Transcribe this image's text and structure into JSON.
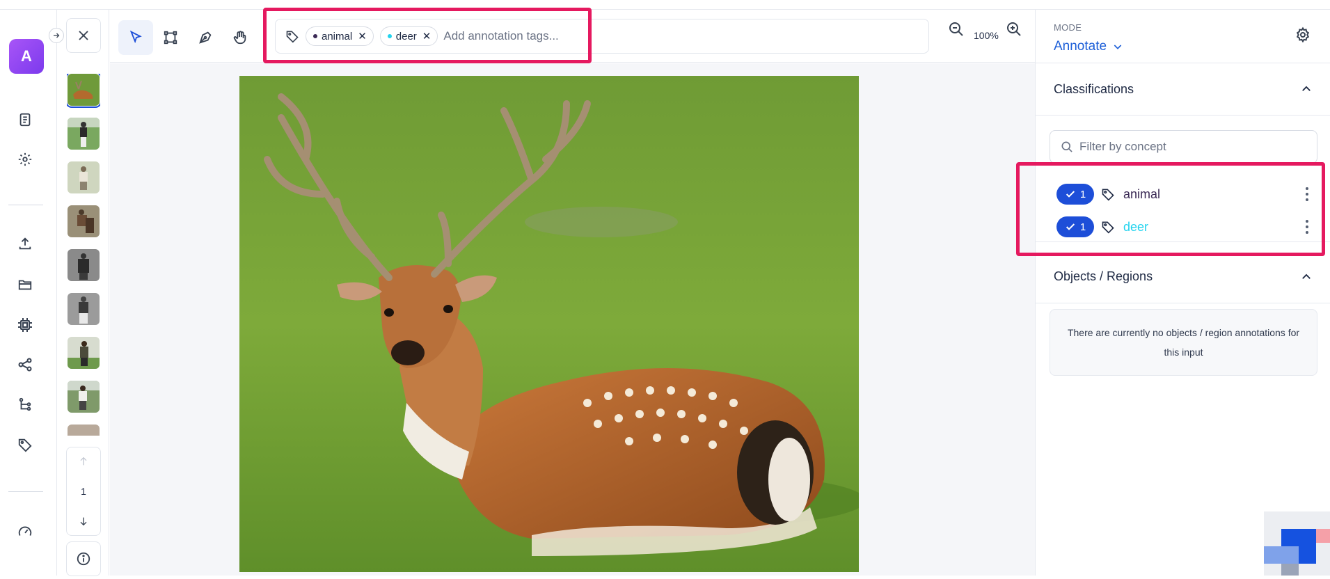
{
  "app": {
    "logo_letter": "A",
    "accent": "#1d4ed8",
    "highlight": "#e5195f"
  },
  "leftnav": {
    "icons": [
      "document-icon",
      "settings-icon",
      "upload-icon",
      "folder-icon",
      "chip-icon",
      "share-icon",
      "workflow-icon",
      "tag-icon",
      "speedometer-icon"
    ]
  },
  "thumbnails": {
    "selected_index": 0,
    "count_visible": 8
  },
  "pager": {
    "page": "1"
  },
  "toolbar": {
    "tools": [
      "select-tool",
      "bounding-box-tool",
      "polygon-pen-tool",
      "pan-hand-tool"
    ],
    "tags": [
      {
        "label": "animal",
        "color": "#3b2a55"
      },
      {
        "label": "deer",
        "color": "#22d3ee"
      }
    ],
    "tag_placeholder": "Add annotation tags...",
    "zoom": "100%"
  },
  "right_panel": {
    "mode_label": "MODE",
    "mode_value": "Annotate",
    "classifications_title": "Classifications",
    "filter_placeholder": "Filter by concept",
    "classifications": [
      {
        "count": "1",
        "label": "animal",
        "color": "#3b2a55"
      },
      {
        "count": "1",
        "label": "deer",
        "color": "#22d3ee"
      }
    ],
    "objects_title": "Objects / Regions",
    "empty_message": "There are currently no objects / region annotations for this input"
  }
}
